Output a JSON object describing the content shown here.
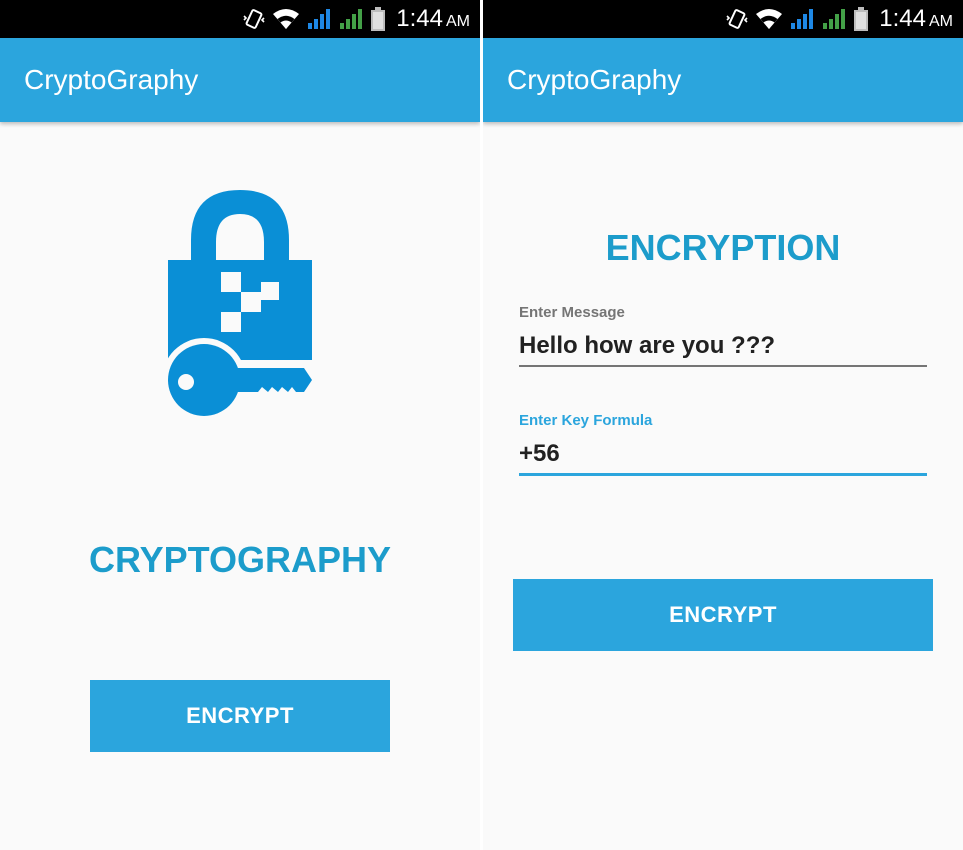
{
  "colors": {
    "primary": "#2ba5dd",
    "title_text": "#1c9ccb",
    "background": "#fafafa",
    "status_bar": "#000000"
  },
  "status_bar": {
    "time": "1:44",
    "ampm": "AM",
    "icons": [
      "vibrate-icon",
      "wifi-icon",
      "signal-sim1-icon",
      "signal-sim2-icon",
      "battery-icon"
    ]
  },
  "left_screen": {
    "app_title": "CryptoGraphy",
    "logo_icon": "lock-key-icon",
    "brand_title": "CRYPTOGRAPHY",
    "button_label": "ENCRYPT"
  },
  "right_screen": {
    "app_title": "CryptoGraphy",
    "section_title": "ENCRYPTION",
    "message_field": {
      "label": "Enter Message",
      "value": "Hello how are you ???"
    },
    "key_field": {
      "label": "Enter Key Formula",
      "value": "+56"
    },
    "button_label": "ENCRYPT"
  }
}
